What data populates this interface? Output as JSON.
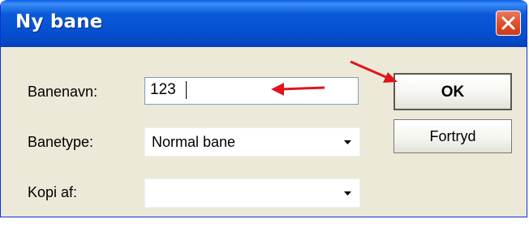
{
  "window": {
    "title": "Ny bane",
    "close_icon": "close-icon"
  },
  "form": {
    "name_label": "Banenavn:",
    "name_value": "123",
    "type_label": "Banetype:",
    "type_value": "Normal bane",
    "copy_label": "Kopi af:",
    "copy_value": ""
  },
  "buttons": {
    "ok_label": "OK",
    "cancel_label": "Fortryd"
  },
  "annotations": {
    "arrow_color": "#e0141c"
  },
  "colors": {
    "titlebar": "#0553d3",
    "dialog_bg": "#ece9d8",
    "close_button": "#e0532f"
  }
}
